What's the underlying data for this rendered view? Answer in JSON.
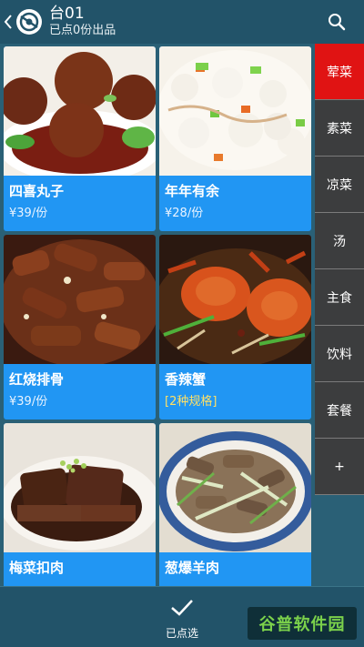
{
  "header": {
    "title": "台01",
    "subtitle": "已点0份出品"
  },
  "dishes": [
    {
      "name": "四喜丸子",
      "price": "¥39/份"
    },
    {
      "name": "年年有余",
      "price": "¥28/份"
    },
    {
      "name": "红烧排骨",
      "price": "¥39/份"
    },
    {
      "name": "香辣蟹",
      "price": "[2种规格]"
    },
    {
      "name": "梅菜扣肉",
      "price": ""
    },
    {
      "name": "葱爆羊肉",
      "price": ""
    }
  ],
  "categories": [
    "荤菜",
    "素菜",
    "凉菜",
    "汤",
    "主食",
    "饮料",
    "套餐",
    "+"
  ],
  "active_category": "荤菜",
  "footer": {
    "confirm_label": "已点选",
    "watermark": "谷普软件园"
  },
  "colors": {
    "header_bg": "#225369",
    "card_bg": "#2196f3",
    "active_category": "#e01313",
    "category_bg": "#3c3d3e"
  }
}
